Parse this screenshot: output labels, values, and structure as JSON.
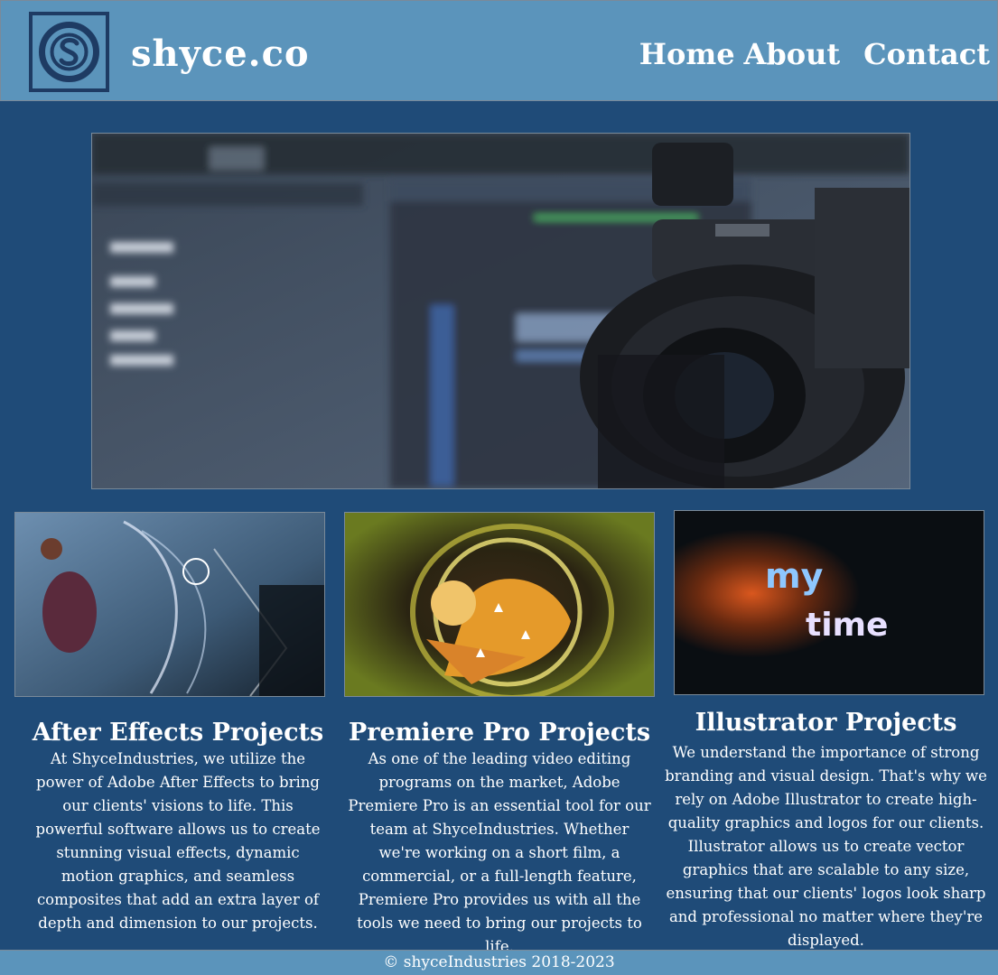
{
  "header": {
    "brand": "shyce.co",
    "nav": {
      "home": "Home",
      "about": "About",
      "contact": "Contact"
    }
  },
  "colors": {
    "header_bg": "#5b94bb",
    "page_bg": "#1f4b78",
    "logo_dark": "#1e3b63",
    "text": "#ffffff"
  },
  "hero": {
    "icon": "video-editing-camera-image"
  },
  "thumbnails": [
    {
      "icon": "after-effects-project-image"
    },
    {
      "icon": "premiere-pro-project-image"
    },
    {
      "icon": "illustrator-project-image",
      "overlay_line1": "my",
      "overlay_line2": "time"
    }
  ],
  "projects": [
    {
      "title": "After Effects Projects",
      "body": "At ShyceIndustries, we utilize the power of Adobe After Effects to bring our clients' visions to life. This powerful software allows us to create stunning visual effects, dynamic motion graphics, and seamless composites that add an extra layer of depth and dimension to our projects."
    },
    {
      "title": "Premiere Pro Projects",
      "body": "As one of the leading video editing programs on the market, Adobe Premiere Pro is an essential tool for our team at ShyceIndustries. Whether we're working on a short film, a commercial, or a full-length feature, Premiere Pro provides us with all the tools we need to bring our projects to life."
    },
    {
      "title": "Illustrator Projects",
      "body": "We understand the importance of strong branding and visual design. That's why we rely on Adobe Illustrator to create high-quality graphics and logos for our clients. Illustrator allows us to create vector graphics that are scalable to any size, ensuring that our clients' logos look sharp and professional no matter where they're displayed."
    }
  ],
  "footer": {
    "text": "© shyceIndustries 2018-2023"
  }
}
